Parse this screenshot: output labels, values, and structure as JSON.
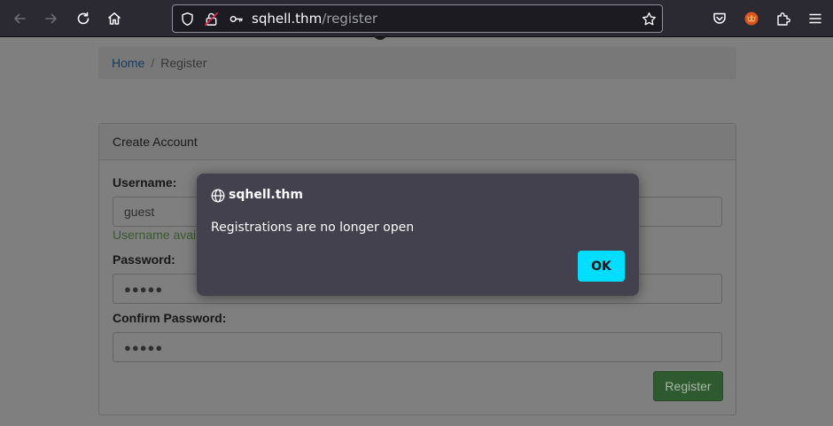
{
  "browser": {
    "url_host": "sqhell.thm",
    "url_path": "/register"
  },
  "breadcrumb": {
    "home": "Home",
    "separator": "/",
    "current": "Register"
  },
  "form": {
    "panel_title": "Create Account",
    "username_label": "Username:",
    "username_value": "guest",
    "username_help": "Username avai",
    "password_label": "Password:",
    "password_value": "●●●●●",
    "confirm_label": "Confirm Password:",
    "confirm_value": "●●●●●",
    "register_label": "Register"
  },
  "dialog": {
    "origin": "sqhell.thm",
    "message": "Registrations are no longer open",
    "ok_label": "OK"
  },
  "colors": {
    "dialog_button": "#00ddff",
    "toolbar": "#2b2a33",
    "dialog": "#42414d"
  }
}
